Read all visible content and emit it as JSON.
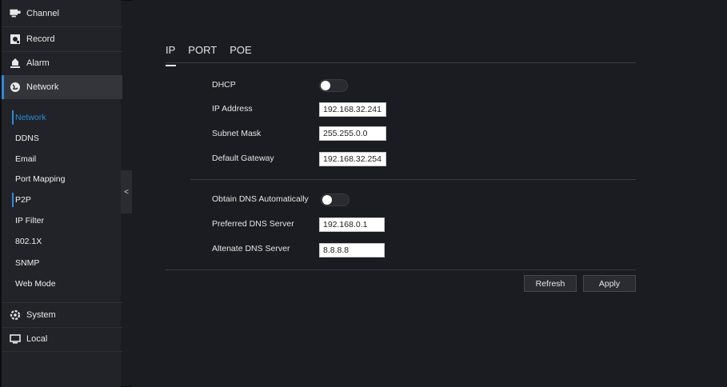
{
  "sidebar": {
    "items": [
      {
        "label": "Channel",
        "icon": "monitor-camera-icon"
      },
      {
        "label": "Record",
        "icon": "record-icon"
      },
      {
        "label": "Alarm",
        "icon": "alarm-icon"
      },
      {
        "label": "Network",
        "icon": "globe-icon"
      },
      {
        "label": "System",
        "icon": "gear-icon"
      },
      {
        "label": "Local",
        "icon": "local-display-icon"
      }
    ],
    "network_sub": [
      {
        "label": "Network"
      },
      {
        "label": "DDNS"
      },
      {
        "label": "Email"
      },
      {
        "label": "Port Mapping"
      },
      {
        "label": "P2P"
      },
      {
        "label": "IP Filter"
      },
      {
        "label": "802.1X"
      },
      {
        "label": "SNMP"
      },
      {
        "label": "Web Mode"
      }
    ],
    "collapse_glyph": "<"
  },
  "tabs": [
    {
      "label": "IP"
    },
    {
      "label": "PORT"
    },
    {
      "label": "POE"
    }
  ],
  "form": {
    "dhcp_label": "DHCP",
    "ip_label": "IP Address",
    "ip_value": "192.168.32.241",
    "mask_label": "Subnet Mask",
    "mask_value": "255.255.0.0",
    "gateway_label": "Default Gateway",
    "gateway_value": "192.168.32.254",
    "dns_auto_label": "Obtain DNS Automatically",
    "dns_pref_label": "Preferred DNS Server",
    "dns_pref_value": "192.168.0.1",
    "dns_alt_label": "Altenate DNS Server",
    "dns_alt_value": "8.8.8.8"
  },
  "buttons": {
    "refresh": "Refresh",
    "apply": "Apply"
  },
  "colors": {
    "accent": "#2a8cd8",
    "background": "#1b1c21",
    "sidebar": "#222328"
  }
}
